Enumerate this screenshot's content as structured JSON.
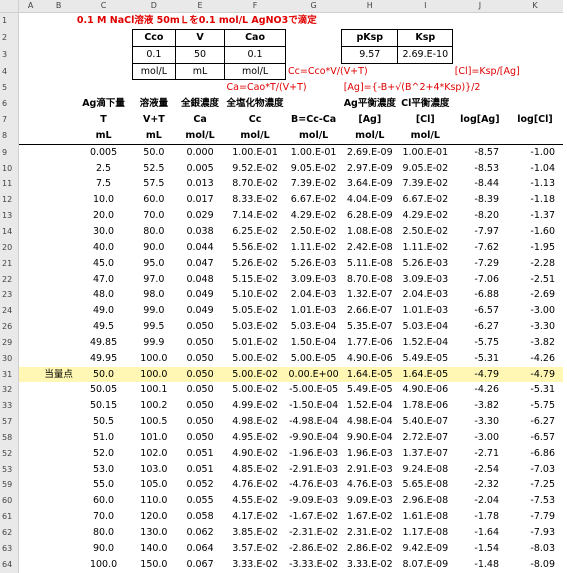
{
  "col_letters": [
    "A",
    "B",
    "C",
    "D",
    "E",
    "F",
    "G",
    "H",
    "I",
    "J",
    "K"
  ],
  "title": "0.1 M NaCl溶液 50mＬを0.1 mol/L AgNO3で滴定",
  "params": {
    "headers": [
      "Cco",
      "V",
      "Cao"
    ],
    "values": [
      "0.1",
      "50",
      "0.1"
    ],
    "units": [
      "mol/L",
      "mL",
      "mol/L"
    ]
  },
  "ksp_box": {
    "headers": [
      "pKsp",
      "Ksp"
    ],
    "values": [
      "9.57",
      "2.69.E-10"
    ]
  },
  "formulas": {
    "cc": "Cc=Cco*V/(V+T)",
    "cl": "[Cl]=Ksp/[Ag]",
    "ca": "Ca=Cao*T/(V+T)",
    "ag": "[Ag]={-B+√(B^2+4*Ksp)}/2"
  },
  "table_header": {
    "row6": [
      "Ag滴下量",
      "溶液量",
      "全銀濃度",
      "全塩化物濃度",
      "",
      "Ag平衡濃度",
      "Cl平衡濃度",
      "",
      ""
    ],
    "row7": [
      "T",
      "V+T",
      "Ca",
      "Cc",
      "B=Cc-Ca",
      "[Ag]",
      "[Cl]",
      "log[Ag]",
      "log[Cl]"
    ],
    "row8": [
      "mL",
      "mL",
      "mol/L",
      "mol/L",
      "mol/L",
      "mol/L",
      "mol/L",
      "",
      ""
    ]
  },
  "equivalence_label": "当量点",
  "rows": [
    {
      "n": "9",
      "v": [
        "0.005",
        "50.0",
        "0.000",
        "1.00.E-01",
        "1.00.E-01",
        "2.69.E-09",
        "1.00.E-01",
        "-8.57",
        "-1.00"
      ]
    },
    {
      "n": "10",
      "v": [
        "2.5",
        "52.5",
        "0.005",
        "9.52.E-02",
        "9.05.E-02",
        "2.97.E-09",
        "9.05.E-02",
        "-8.53",
        "-1.04"
      ]
    },
    {
      "n": "11",
      "v": [
        "7.5",
        "57.5",
        "0.013",
        "8.70.E-02",
        "7.39.E-02",
        "3.64.E-09",
        "7.39.E-02",
        "-8.44",
        "-1.13"
      ]
    },
    {
      "n": "12",
      "v": [
        "10.0",
        "60.0",
        "0.017",
        "8.33.E-02",
        "6.67.E-02",
        "4.04.E-09",
        "6.67.E-02",
        "-8.39",
        "-1.18"
      ]
    },
    {
      "n": "13",
      "v": [
        "20.0",
        "70.0",
        "0.029",
        "7.14.E-02",
        "4.29.E-02",
        "6.28.E-09",
        "4.29.E-02",
        "-8.20",
        "-1.37"
      ]
    },
    {
      "n": "14",
      "v": [
        "30.0",
        "80.0",
        "0.038",
        "6.25.E-02",
        "2.50.E-02",
        "1.08.E-08",
        "2.50.E-02",
        "-7.97",
        "-1.60"
      ]
    },
    {
      "n": "20",
      "v": [
        "40.0",
        "90.0",
        "0.044",
        "5.56.E-02",
        "1.11.E-02",
        "2.42.E-08",
        "1.11.E-02",
        "-7.62",
        "-1.95"
      ]
    },
    {
      "n": "21",
      "v": [
        "45.0",
        "95.0",
        "0.047",
        "5.26.E-02",
        "5.26.E-03",
        "5.11.E-08",
        "5.26.E-03",
        "-7.29",
        "-2.28"
      ]
    },
    {
      "n": "22",
      "v": [
        "47.0",
        "97.0",
        "0.048",
        "5.15.E-02",
        "3.09.E-03",
        "8.70.E-08",
        "3.09.E-03",
        "-7.06",
        "-2.51"
      ]
    },
    {
      "n": "23",
      "v": [
        "48.0",
        "98.0",
        "0.049",
        "5.10.E-02",
        "2.04.E-03",
        "1.32.E-07",
        "2.04.E-03",
        "-6.88",
        "-2.69"
      ]
    },
    {
      "n": "24",
      "v": [
        "49.0",
        "99.0",
        "0.049",
        "5.05.E-02",
        "1.01.E-03",
        "2.66.E-07",
        "1.01.E-03",
        "-6.57",
        "-3.00"
      ]
    },
    {
      "n": "26",
      "v": [
        "49.5",
        "99.5",
        "0.050",
        "5.03.E-02",
        "5.03.E-04",
        "5.35.E-07",
        "5.03.E-04",
        "-6.27",
        "-3.30"
      ]
    },
    {
      "n": "29",
      "v": [
        "49.85",
        "99.9",
        "0.050",
        "5.01.E-02",
        "1.50.E-04",
        "1.77.E-06",
        "1.52.E-04",
        "-5.75",
        "-3.82"
      ]
    },
    {
      "n": "30",
      "v": [
        "49.95",
        "100.0",
        "0.050",
        "5.00.E-02",
        "5.00.E-05",
        "4.90.E-06",
        "5.49.E-05",
        "-5.31",
        "-4.26"
      ]
    },
    {
      "n": "31",
      "v": [
        "50.0",
        "100.0",
        "0.050",
        "5.00.E-02",
        "0.00.E+00",
        "1.64.E-05",
        "1.64.E-05",
        "-4.79",
        "-4.79"
      ],
      "eq": true
    },
    {
      "n": "32",
      "v": [
        "50.05",
        "100.1",
        "0.050",
        "5.00.E-02",
        "-5.00.E-05",
        "5.49.E-05",
        "4.90.E-06",
        "-4.26",
        "-5.31"
      ]
    },
    {
      "n": "33",
      "v": [
        "50.15",
        "100.2",
        "0.050",
        "4.99.E-02",
        "-1.50.E-04",
        "1.52.E-04",
        "1.78.E-06",
        "-3.82",
        "-5.75"
      ]
    },
    {
      "n": "57",
      "v": [
        "50.5",
        "100.5",
        "0.050",
        "4.98.E-02",
        "-4.98.E-04",
        "4.98.E-04",
        "5.40.E-07",
        "-3.30",
        "-6.27"
      ]
    },
    {
      "n": "58",
      "v": [
        "51.0",
        "101.0",
        "0.050",
        "4.95.E-02",
        "-9.90.E-04",
        "9.90.E-04",
        "2.72.E-07",
        "-3.00",
        "-6.57"
      ]
    },
    {
      "n": "52",
      "v": [
        "52.0",
        "102.0",
        "0.051",
        "4.90.E-02",
        "-1.96.E-03",
        "1.96.E-03",
        "1.37.E-07",
        "-2.71",
        "-6.86"
      ]
    },
    {
      "n": "53",
      "v": [
        "53.0",
        "103.0",
        "0.051",
        "4.85.E-02",
        "-2.91.E-03",
        "2.91.E-03",
        "9.24.E-08",
        "-2.54",
        "-7.03"
      ]
    },
    {
      "n": "59",
      "v": [
        "55.0",
        "105.0",
        "0.052",
        "4.76.E-02",
        "-4.76.E-03",
        "4.76.E-03",
        "5.65.E-08",
        "-2.32",
        "-7.25"
      ]
    },
    {
      "n": "60",
      "v": [
        "60.0",
        "110.0",
        "0.055",
        "4.55.E-02",
        "-9.09.E-03",
        "9.09.E-03",
        "2.96.E-08",
        "-2.04",
        "-7.53"
      ]
    },
    {
      "n": "61",
      "v": [
        "70.0",
        "120.0",
        "0.058",
        "4.17.E-02",
        "-1.67.E-02",
        "1.67.E-02",
        "1.61.E-08",
        "-1.78",
        "-7.79"
      ]
    },
    {
      "n": "62",
      "v": [
        "80.0",
        "130.0",
        "0.062",
        "3.85.E-02",
        "-2.31.E-02",
        "2.31.E-02",
        "1.17.E-08",
        "-1.64",
        "-7.93"
      ]
    },
    {
      "n": "63",
      "v": [
        "90.0",
        "140.0",
        "0.064",
        "3.57.E-02",
        "-2.86.E-02",
        "2.86.E-02",
        "9.42.E-09",
        "-1.54",
        "-8.03"
      ]
    },
    {
      "n": "64",
      "v": [
        "100.0",
        "150.0",
        "0.067",
        "3.33.E-02",
        "-3.33.E-02",
        "3.33.E-02",
        "8.07.E-09",
        "-1.48",
        "-8.09"
      ]
    }
  ]
}
